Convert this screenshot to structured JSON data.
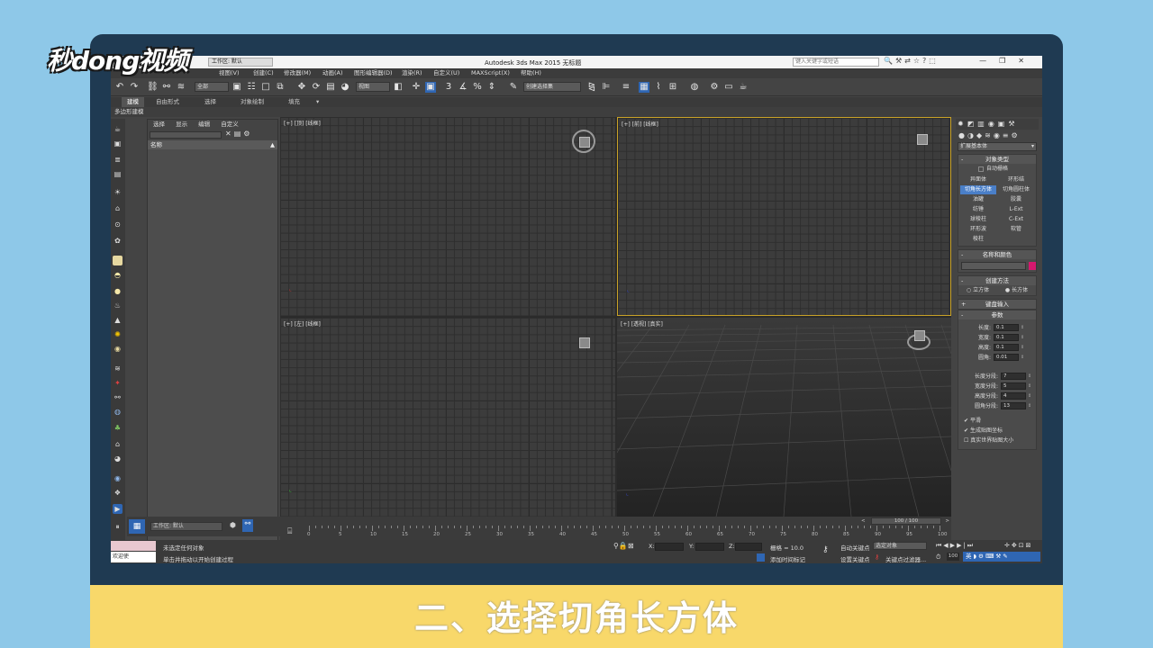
{
  "brand": {
    "logo_text": "秒dong视频"
  },
  "caption": {
    "text": "二、选择切角长方体"
  },
  "titlebar": {
    "title": "Autodesk 3ds Max  2015    无标题",
    "workspace": "工作区: 默认",
    "search_placeholder": "键入关键字或短语",
    "window_controls": [
      "—",
      "❐",
      "✕"
    ]
  },
  "menu": {
    "items": [
      "视图(V)",
      "创建(C)",
      "修改器(M)",
      "动画(A)",
      "图形编辑器(D)",
      "渲染(R)",
      "自定义(U)",
      "MAXScript(X)",
      "帮助(H)"
    ]
  },
  "toolbar": {
    "filter_dropdown": "全部",
    "view_dropdown": "视图",
    "selection_set_dropdown": "创建选择集"
  },
  "ribbon": {
    "tabs": [
      "建模",
      "自由形式",
      "选择",
      "对象绘制",
      "填充"
    ],
    "active_tab": "建模",
    "sub_label": "多边形建模"
  },
  "scene_explorer": {
    "tabs": [
      "选择",
      "显示",
      "编辑",
      "自定义"
    ],
    "column_header": "名称",
    "workspace_label": "工作区: 默认"
  },
  "viewports": {
    "top": "[+] [顶] [线框]",
    "front": "[+] [前] [线框]",
    "left": "[+] [左] [线框]",
    "perspective": "[+] [透视] [真实]"
  },
  "command_panel": {
    "category_dropdown": "扩展基本体",
    "object_type": {
      "title": "对象类型",
      "autogrid": "自动栅格",
      "buttons": [
        "异面体",
        "环形结",
        "切角长方体",
        "切角圆柱体",
        "油罐",
        "胶囊",
        "纺锤",
        "L-Ext",
        "球棱柱",
        "C-Ext",
        "环形波",
        "软管",
        "棱柱"
      ],
      "selected": "切角长方体"
    },
    "name_color": {
      "title": "名称和颜色",
      "color": "#d6186e"
    },
    "creation_method": {
      "title": "创建方法",
      "options": [
        "立方体",
        "长方体"
      ],
      "selected": "长方体"
    },
    "keyboard_entry": {
      "title": "键盘输入"
    },
    "parameters": {
      "title": "参数",
      "fields": [
        {
          "label": "长度:",
          "value": "0.1"
        },
        {
          "label": "宽度:",
          "value": "0.1"
        },
        {
          "label": "高度:",
          "value": "0.1"
        },
        {
          "label": "圆角:",
          "value": "0.01"
        }
      ],
      "segments": [
        {
          "label": "长度分段:",
          "value": "7"
        },
        {
          "label": "宽度分段:",
          "value": "5"
        },
        {
          "label": "高度分段:",
          "value": "4"
        },
        {
          "label": "圆角分段:",
          "value": "13"
        }
      ],
      "checks": [
        {
          "label": "平滑",
          "checked": true
        },
        {
          "label": "生成贴图坐标",
          "checked": true
        },
        {
          "label": "真实世界贴图大小",
          "checked": false
        }
      ]
    }
  },
  "timeline": {
    "frame_counter": "100 / 100",
    "ticks": [
      "0",
      "5",
      "10",
      "15",
      "20",
      "25",
      "30",
      "35",
      "40",
      "45",
      "50",
      "55",
      "60",
      "65",
      "70",
      "75",
      "80",
      "85",
      "90",
      "95",
      "100"
    ]
  },
  "status": {
    "selection": "未选定任何对象",
    "prompt": "单击并拖动以开始创建过程",
    "maxscript": "欢迎使",
    "x_label": "X:",
    "y_label": "Y:",
    "z_label": "Z:",
    "grid": "栅格 = 10.0",
    "add_time_tag": "添加时间标记",
    "autokey": "自动关键点",
    "setkey": "设置关键点",
    "selected_dropdown": "选定对象",
    "key_filter": "关键点过滤器...",
    "frame_field": "100",
    "ime": "英"
  }
}
